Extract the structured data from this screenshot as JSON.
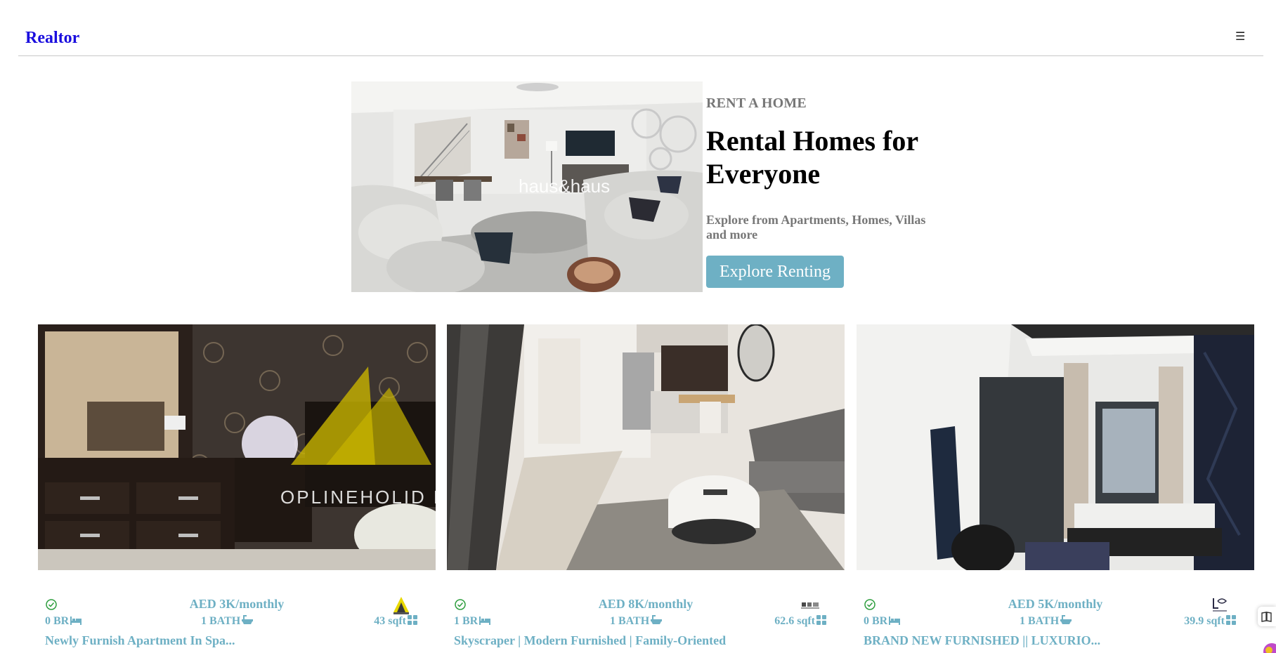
{
  "app": {
    "brand": "Realtor",
    "menu_glyph": "☰"
  },
  "hero": {
    "kicker": "RENT A HOME",
    "title": "Rental Homes for Everyone",
    "description": "Explore from Apartments, Homes, Villas and more",
    "button_label": "Explore Renting"
  },
  "colors": {
    "accent": "#6eb0c4",
    "brand": "#1a0dde",
    "muted": "#777777",
    "verified": "#2e9e3e"
  },
  "listings": [
    {
      "price": "AED 3K/monthly",
      "beds": "0 BR",
      "baths": "1 BATH",
      "area": "43 sqft",
      "title": "Newly Furnish Apartment In Spa...",
      "verified": true,
      "agency_logo": "topline-holiday-homes-logo"
    },
    {
      "price": "AED 8K/monthly",
      "beds": "1 BR",
      "baths": "1 BATH",
      "area": "62.6 sqft",
      "title": "Skyscraper | Modern Furnished | Family-Oriented",
      "verified": true,
      "agency_logo": "live-home-logo"
    },
    {
      "price": "AED 5K/monthly",
      "beds": "0 BR",
      "baths": "1 BATH",
      "area": "39.9 sqft",
      "title": "BRAND NEW FURNISHED || LUXURIO...",
      "verified": true,
      "agency_logo": "luxury-agency-logo"
    }
  ],
  "image_watermarks": {
    "hero": "haus&haus",
    "listing_1": "OPLINEHOLID HOM"
  }
}
